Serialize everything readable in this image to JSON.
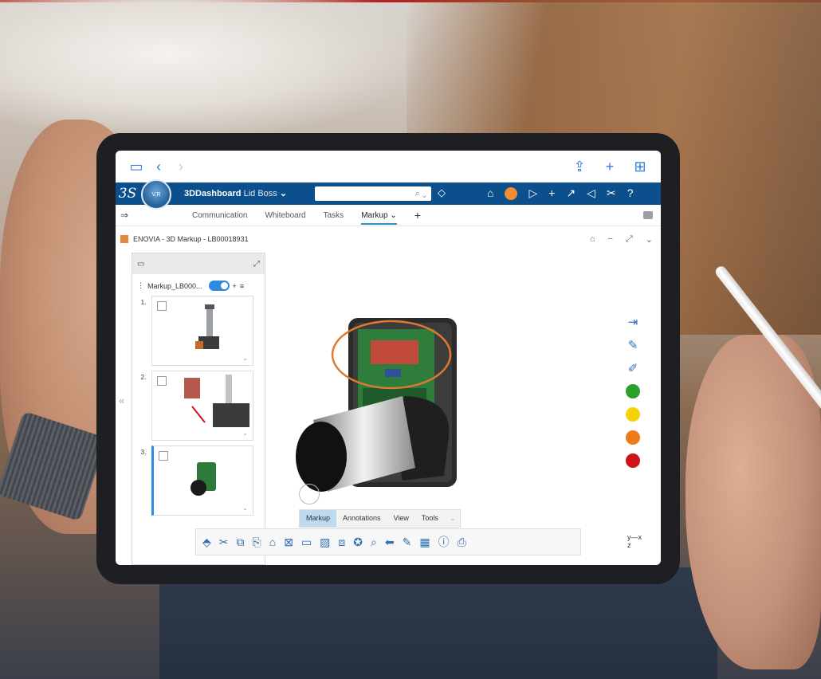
{
  "dashboard": {
    "app_name": "3DDashboard",
    "dashboard_name": "Lid Boss",
    "compass_label": "V,R",
    "compass_3d": "3D"
  },
  "tabs": [
    {
      "label": "Communication"
    },
    {
      "label": "Whiteboard"
    },
    {
      "label": "Tasks"
    },
    {
      "label": "Markup"
    }
  ],
  "app": {
    "title": "ENOVIA - 3D Markup - LB00018931"
  },
  "markup_panel": {
    "name": "Markup_LB000...",
    "items": [
      {
        "num": "1."
      },
      {
        "num": "2."
      },
      {
        "num": "3."
      }
    ]
  },
  "view_tabs": [
    {
      "label": "Markup"
    },
    {
      "label": "Annotations"
    },
    {
      "label": "View"
    },
    {
      "label": "Tools"
    }
  ],
  "axis": {
    "y": "y",
    "x": "x",
    "z": "z"
  },
  "colors": {
    "brand": "#0b4f8c",
    "accent": "#2f8be0",
    "markup_colors": [
      "#2ca02c",
      "#f4d20a",
      "#ee7b1b",
      "#d0121b"
    ],
    "annotation_stroke": "#e07a2e"
  }
}
